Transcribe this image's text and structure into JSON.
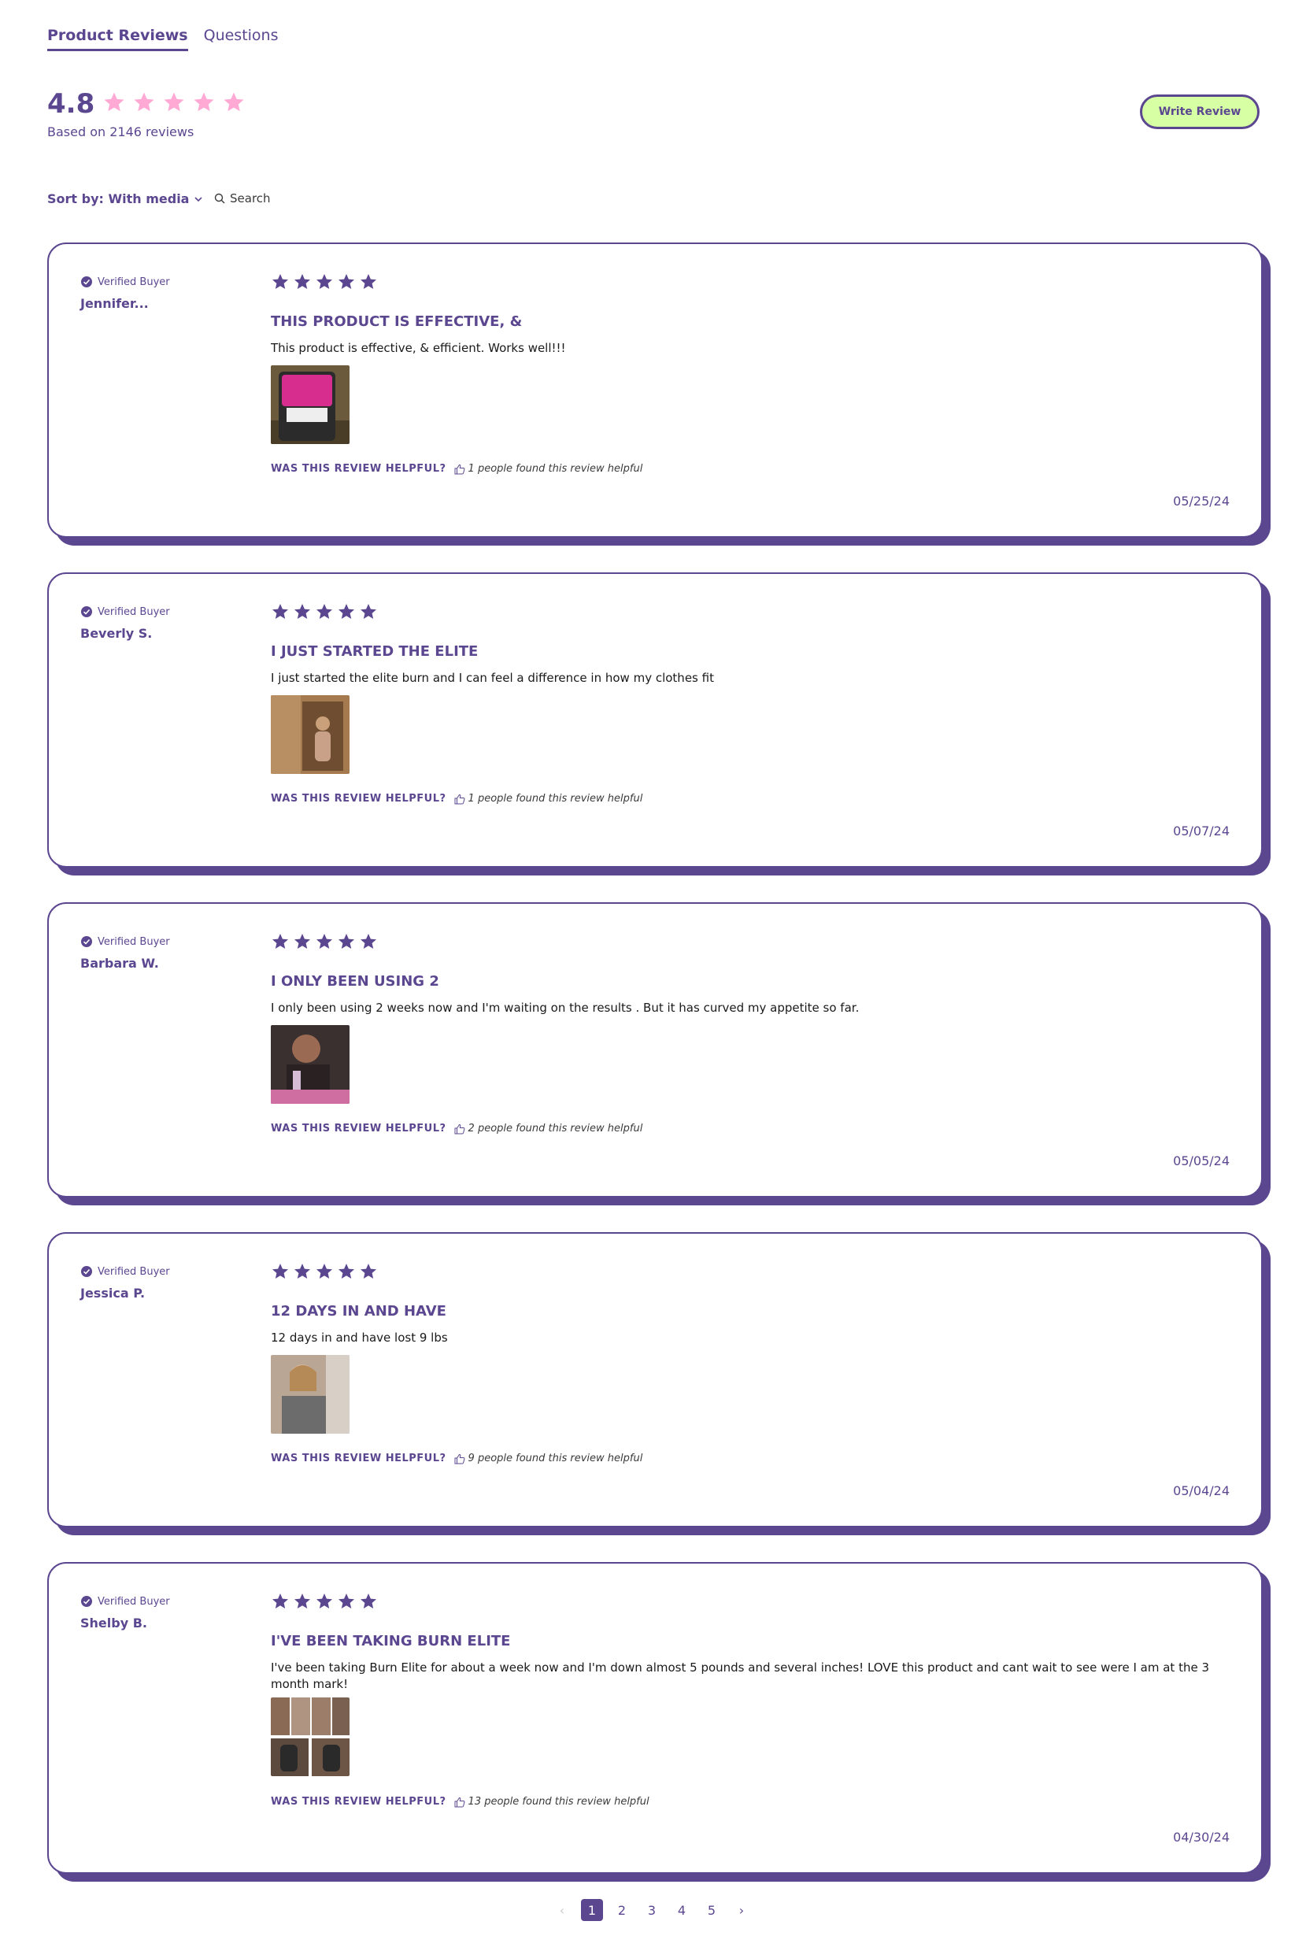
{
  "tabs": [
    "Product Reviews",
    "Questions"
  ],
  "summary": {
    "average": "4.8",
    "based_on": "Based on 2146 reviews",
    "star_color": "#ffa9d4"
  },
  "write_review_label": "Write Review",
  "sort": {
    "label": "Sort by: With media"
  },
  "search": {
    "label": "Search"
  },
  "colors": {
    "brand": "#5b4690",
    "button_bg": "#d7ffa4"
  },
  "reviews": [
    {
      "verified": "Verified Buyer",
      "author": "Jennifer...",
      "rating": 5,
      "title": "THIS PRODUCT IS EFFECTIVE, &",
      "body": "This product is effective, & efficient. Works well!!!",
      "helpful_q": "WAS THIS REVIEW HELPFUL?",
      "helpful": "1 people found this review helpful",
      "date": "05/25/24"
    },
    {
      "verified": "Verified Buyer",
      "author": "Beverly S.",
      "rating": 5,
      "title": "I JUST STARTED THE ELITE",
      "body": "I just started the elite burn and I can feel a difference in how my clothes fit",
      "helpful_q": "WAS THIS REVIEW HELPFUL?",
      "helpful": "1 people found this review helpful",
      "date": "05/07/24"
    },
    {
      "verified": "Verified Buyer",
      "author": "Barbara W.",
      "rating": 5,
      "title": "I ONLY BEEN USING 2",
      "body": "I only been using 2 weeks now and I'm waiting on the results . But it has curved my appetite so far.",
      "helpful_q": "WAS THIS REVIEW HELPFUL?",
      "helpful": "2 people found this review helpful",
      "date": "05/05/24"
    },
    {
      "verified": "Verified Buyer",
      "author": "Jessica P.",
      "rating": 5,
      "title": "12 DAYS IN AND HAVE",
      "body": "12 days in and have lost 9 lbs",
      "helpful_q": "WAS THIS REVIEW HELPFUL?",
      "helpful": "9 people found this review helpful",
      "date": "05/04/24"
    },
    {
      "verified": "Verified Buyer",
      "author": "Shelby B.",
      "rating": 5,
      "title": "I'VE BEEN TAKING BURN ELITE",
      "body": "I've been taking Burn Elite for about a week now and I'm down almost 5 pounds and several inches! LOVE this product and cant wait to see were I am at the 3 month mark!",
      "helpful_q": "WAS THIS REVIEW HELPFUL?",
      "helpful": "13 people found this review helpful",
      "date": "04/30/24"
    }
  ],
  "pagination": {
    "pages": [
      "1",
      "2",
      "3",
      "4",
      "5"
    ],
    "current": "1",
    "prev": "‹",
    "next": "›"
  }
}
